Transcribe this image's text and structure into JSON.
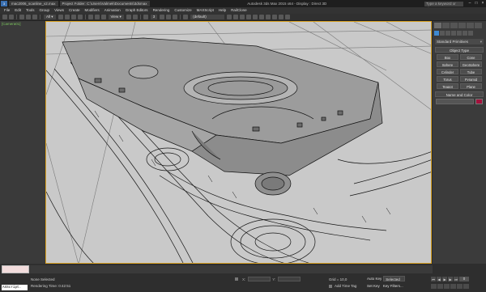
{
  "titlebar": {
    "file_tab": "mac2006_scanline_v2.max",
    "project": "Project Folder: C:\\Users\\Valmek\\Documents\\3dsmax",
    "app": "Autodesk 3ds Max 2015 x64 - Display : Direct 3D",
    "search_placeholder": "Type a keyword or phrase"
  },
  "menu": [
    "File",
    "Edit",
    "Tools",
    "Group",
    "Views",
    "Create",
    "Modifiers",
    "Animation",
    "Graph Editors",
    "Rendering",
    "Customize",
    "MAXScript",
    "Help",
    "RailClone"
  ],
  "toolbar": {
    "view_dropdown": "View",
    "snap_value": "3",
    "selection_set": "(default)"
  },
  "viewport": {
    "label": "[Camera01]",
    "colors": {
      "background": "#c8c8c8",
      "lines": "#1a1a1a",
      "frame": "#d8a020"
    }
  },
  "command_panel": {
    "category": "Standard Primitives",
    "object_type_title": "Object Type",
    "buttons": [
      "Box",
      "Cone",
      "Sphere",
      "GeoSphere",
      "Cylinder",
      "Tube",
      "Torus",
      "Pyramid",
      "Teapot",
      "Plane"
    ],
    "name_color_title": "Name and Color",
    "swatch_color": "#a3123c"
  },
  "status": {
    "selection": "None Selected",
    "render_time": "Rendering Time: 0:42:51",
    "grid": "Grid = 10,0",
    "add_time_tag": "Add Time Tag",
    "auto_key": "Auto Key",
    "set_key": "Set Key",
    "key_mode": "Selected",
    "key_filters": "Key Filters...",
    "frame": "0"
  },
  "maxscript": {
    "mini_label": "AXScript."
  }
}
